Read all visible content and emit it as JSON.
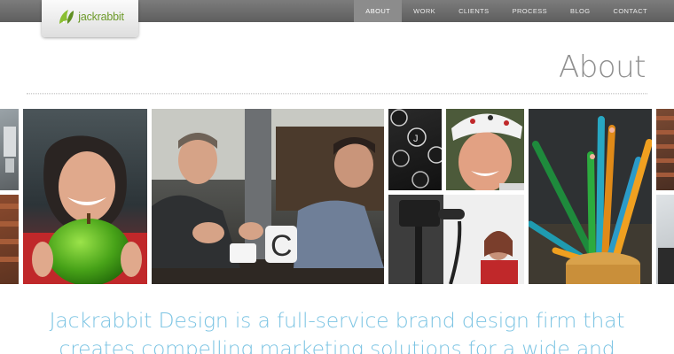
{
  "brand": {
    "name": "jackrabbit",
    "logo_icon": "rabbit-leaf-icon",
    "accent_green": "#6d9a2a"
  },
  "nav": {
    "items": [
      {
        "label": "ABOUT",
        "active": true
      },
      {
        "label": "WORK",
        "active": false
      },
      {
        "label": "CLIENTS",
        "active": false
      },
      {
        "label": "PROCESS",
        "active": false
      },
      {
        "label": "BLOG",
        "active": false
      },
      {
        "label": "CONTACT",
        "active": false
      }
    ]
  },
  "page": {
    "title": "About"
  },
  "collage": {
    "photos": [
      "woman-holding-green-apple",
      "two-men-laughing-at-table",
      "typewriter-keys",
      "man-in-cycling-cap",
      "video-camera-interview",
      "colored-pencils-in-cup"
    ]
  },
  "intro": {
    "text": "Jackrabbit Design is a full-service brand design firm that creates compelling marketing solutions for a wide and",
    "color": "#7cc4e3"
  }
}
